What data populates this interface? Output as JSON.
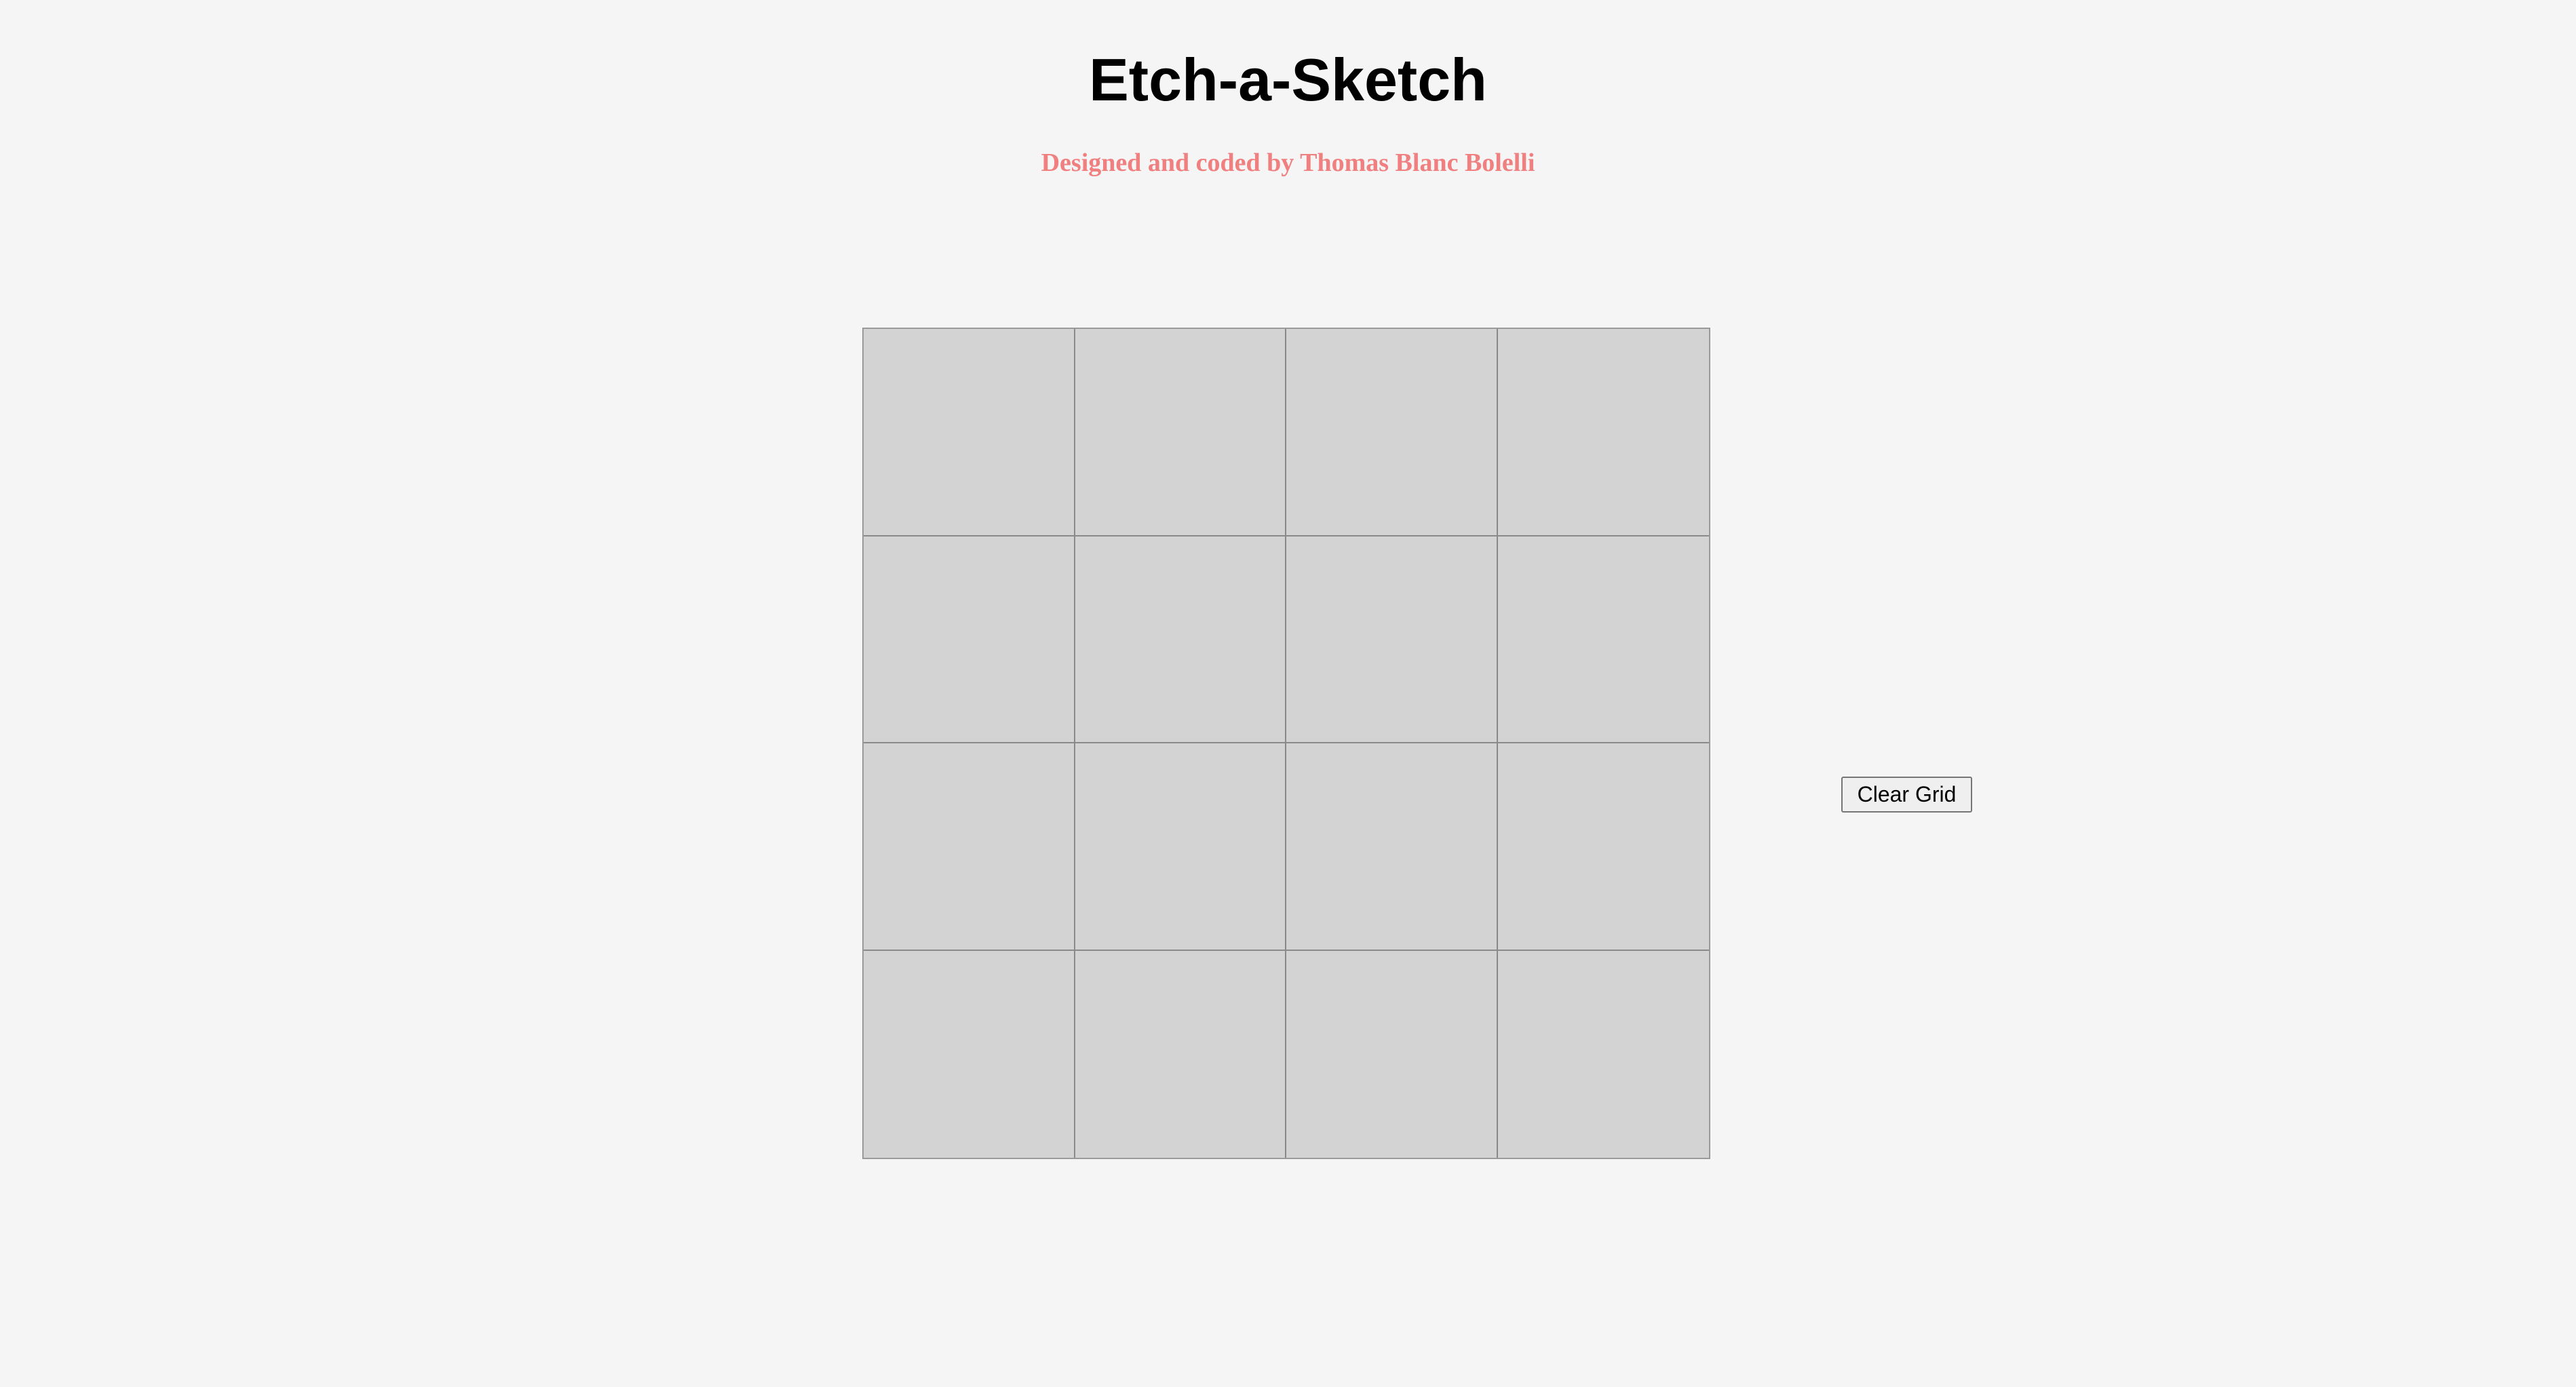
{
  "header": {
    "title": "Etch-a-Sketch",
    "byline": "Designed and coded by Thomas Blanc Bolelli"
  },
  "grid": {
    "rows": 4,
    "columns": 4,
    "cell_color": "#d3d3d3",
    "line_color": "#8a8a8a"
  },
  "controls": {
    "clear_label": "Clear Grid"
  },
  "colors": {
    "background": "#f5f5f5",
    "byline": "#f08080",
    "title": "#000000"
  }
}
